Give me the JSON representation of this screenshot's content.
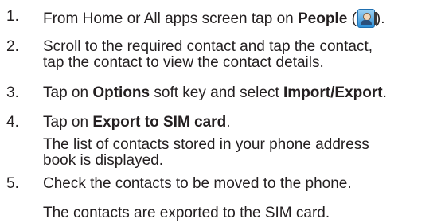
{
  "steps": [
    {
      "number": "1.",
      "text_before": "From Home or All apps screen tap on ",
      "bold": "People",
      "text_after_open": " (",
      "text_after_close": ").",
      "icon": "people-app-icon"
    },
    {
      "number": "2.",
      "line1": "Scroll to the required contact and tap the contact,",
      "line2": "tap the contact to view the contact details."
    },
    {
      "number": "3.",
      "text_before": "Tap on ",
      "bold1": "Options",
      "text_middle": " soft key and select ",
      "bold2": "Import/Export",
      "text_after": "."
    },
    {
      "number": "4.",
      "text_before": "Tap on ",
      "bold": "Export to SIM card",
      "text_after": ".",
      "note_line1": "The list of contacts stored in your phone address",
      "note_line2": "book is displayed."
    },
    {
      "number": "5.",
      "text": "Check the contacts to be moved to the phone."
    }
  ],
  "result": "The contacts are exported to the SIM card.",
  "colors": {
    "text": "#231f20",
    "heading_fragment": "#e0202a"
  }
}
